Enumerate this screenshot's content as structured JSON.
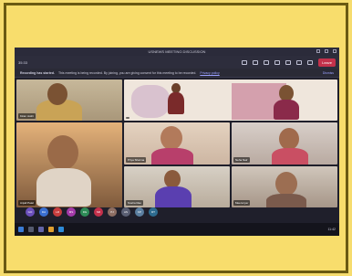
{
  "window": {
    "title": "USNEWS MEETING DISCUSSION"
  },
  "toolbar": {
    "timer": "35:33",
    "leave_label": "Leave"
  },
  "banner": {
    "heading": "Recording has started.",
    "message": "This meeting is being recorded. By joining, you are giving consent for this meeting to be recorded.",
    "privacy_link": "Privacy policy",
    "dismiss_label": "Dismiss"
  },
  "participants": [
    {
      "name": "Kiran Joshi"
    },
    {
      "name": ""
    },
    {
      "name": "Priya Sharma"
    },
    {
      "name": "Neha Nair"
    },
    {
      "name": "Anjali Patel"
    },
    {
      "name": "Sneha Rao"
    },
    {
      "name": "Meera Iyer"
    }
  ],
  "avatars": [
    {
      "initials": "GO",
      "color": "#6b4fbb"
    },
    {
      "initials": "DA",
      "color": "#3a6fd0"
    },
    {
      "initials": "LR",
      "color": "#c83d3d"
    },
    {
      "initials": "MS",
      "color": "#a43aa8"
    },
    {
      "initials": "DG",
      "color": "#2e8b57"
    },
    {
      "initials": "SR",
      "color": "#c4314b"
    },
    {
      "initials": "PJ",
      "color": "#8d6e63"
    },
    {
      "initials": "AS",
      "color": "#5a5f73"
    },
    {
      "initials": "KP",
      "color": "#5b7fa0"
    },
    {
      "initials": "RT",
      "color": "#2d6b8f"
    }
  ],
  "taskbar": {
    "clock": "11:42"
  }
}
